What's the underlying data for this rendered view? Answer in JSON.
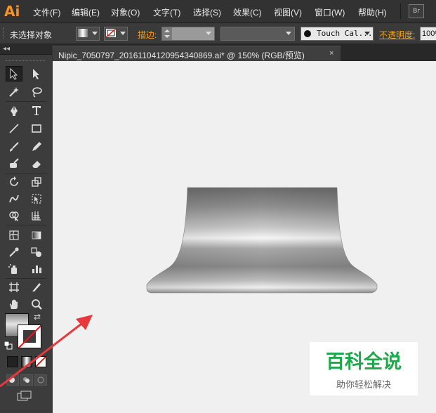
{
  "app": {
    "logo": "Ai",
    "bridge_label": "Br"
  },
  "menu": [
    "文件(F)",
    "编辑(E)",
    "对象(O)",
    "文字(T)",
    "选择(S)",
    "效果(C)",
    "视图(V)",
    "窗口(W)",
    "帮助(H)"
  ],
  "control": {
    "selection_status": "未选择对象",
    "stroke_label": "描边:",
    "graphic_style": "Touch Cal...",
    "opacity_label": "不透明度:",
    "opacity_value": "100%"
  },
  "document": {
    "tab_title": "Nipic_7050797_20161104120954340869.ai* @ 150% (RGB/预览)",
    "close_label": "×"
  },
  "icons": [
    "selection-tool-icon",
    "direct-selection-tool-icon",
    "magic-wand-tool-icon",
    "lasso-tool-icon",
    "pen-tool-icon",
    "type-tool-icon",
    "line-tool-icon",
    "rectangle-tool-icon",
    "paintbrush-tool-icon",
    "pencil-tool-icon",
    "blob-brush-tool-icon",
    "eraser-tool-icon",
    "rotate-tool-icon",
    "scale-tool-icon",
    "warp-tool-icon",
    "free-transform-tool-icon",
    "shape-builder-tool-icon",
    "perspective-grid-tool-icon",
    "mesh-tool-icon",
    "gradient-tool-icon",
    "eyedropper-tool-icon",
    "blend-tool-icon",
    "symbol-sprayer-tool-icon",
    "column-graph-tool-icon",
    "artboard-tool-icon",
    "slice-tool-icon",
    "hand-tool-icon",
    "zoom-tool-icon"
  ],
  "colors": {
    "accent": "#f0a020",
    "arrow": "#e8383d",
    "watermark_green": "#1fa84b"
  },
  "watermark": {
    "title": "百科全说",
    "subtitle": "助你轻松解决"
  }
}
